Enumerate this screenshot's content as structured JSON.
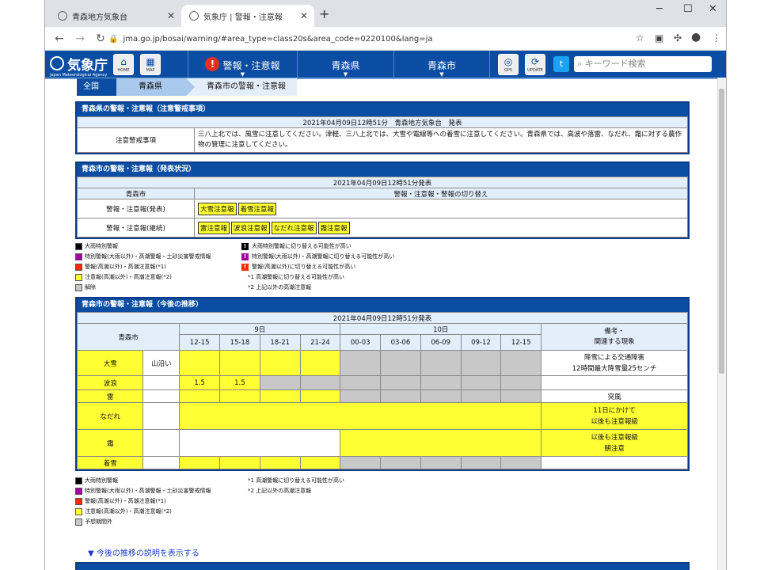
{
  "browser": {
    "tabs": [
      {
        "title": "青森地方気象台"
      },
      {
        "title": "気象庁 | 警報・注意報"
      }
    ],
    "url": "jma.go.jp/bosai/warning/#area_type=class20s&area_code=0220100&lang=ja"
  },
  "site": {
    "logo_text": "気象庁",
    "logo_en": "Japan Meteorological Agency",
    "home_label": "HOME",
    "map_label": "MAP",
    "menu": [
      {
        "label": "警報・注意報"
      },
      {
        "label": "青森県"
      },
      {
        "label": "青森市"
      }
    ],
    "gps_label": "GPS",
    "update_label": "UPDATE",
    "search_placeholder": "キーワード検索"
  },
  "breadcrumb": [
    "全国",
    "青森県",
    "青森市の警報・注意報"
  ],
  "sec1": {
    "title": "青森県の警報・注意報（注意警戒事項）",
    "issued": "2021年04月09日12時51分　青森地方気象台　発表",
    "row_label": "注意警戒事項",
    "text": "三八上北では、風雪に注意してください。津軽、三八上北では、大雪や電線等への着雪に注意してください。青森県では、高波や落雷、なだれ、霜に対する農作物の管理に注意してください。"
  },
  "sec2": {
    "title": "青森市の警報・注意報（発表状況）",
    "issued": "2021年04月09日12時51分発表",
    "col1": "青森市",
    "col2": "警報・注意報・警報の切り替え",
    "row1_label": "警報・注意報(発表)",
    "row1_tags": [
      "大雪注意報",
      "着雪注意報"
    ],
    "row2_label": "警報・注意報(継続)",
    "row2_tags": [
      "雷注意報",
      "波浪注意報",
      "なだれ注意報",
      "霜注意報"
    ]
  },
  "legend1": {
    "left": [
      "大雨特別警報",
      "特別警報(大雨以外)・高潮警報・土砂災害警戒情報",
      "警報(高潮以外)・高潮注意報(*1)",
      "注意報(高潮以外)・高潮注意報(*2)",
      "解除"
    ],
    "right": [
      "大雨特別警報に切り替える可能性が高い",
      "特別警報(大雨以外)・高潮警報に切り替える可能性が高い",
      "警報(高潮以外)に切り替える可能性が高い",
      "*1 高潮警報に切り替える可能性が高い",
      "*2 上記以外の高潮注意報"
    ],
    "colors": [
      "#000000",
      "#a000a0",
      "#ff2800",
      "#ffff33",
      "#c8c8c8"
    ]
  },
  "sec3": {
    "title": "青森市の警報・注意報（今後の推移）",
    "issued": "2021年04月09日12時51分発表",
    "area": "青森市",
    "day1": "9日",
    "day2": "10日",
    "times": [
      "12-15",
      "15-18",
      "18-21",
      "21-24",
      "00-03",
      "03-06",
      "06-09",
      "09-12",
      "12-15"
    ],
    "remark_header1": "備考・",
    "remark_header2": "関連する現象",
    "rows": [
      {
        "name": "大雪",
        "sub": "山沿い",
        "remark": [
          "降雪による交通障害",
          "12時間最大降雪量25センチ"
        ]
      },
      {
        "name": "波浪",
        "sub": "",
        "cells": [
          "1.5",
          "1.5"
        ],
        "remark": []
      },
      {
        "name": "雷",
        "sub": "",
        "remark": [
          "突風"
        ]
      },
      {
        "name": "なだれ",
        "sub": "",
        "remark": [
          "11日にかけて",
          "以後も注意報級"
        ]
      },
      {
        "name": "霜",
        "sub": "",
        "remark": [
          "以後も注意報級",
          "朝注意"
        ]
      },
      {
        "name": "着雪",
        "sub": "",
        "remark": []
      }
    ]
  },
  "legend2": {
    "left": [
      "大雨特別警報",
      "特別警報(大雨以外)・高潮警報・土砂災害警戒情報",
      "警報(高潮以外)・高潮注意報(*1)",
      "注意報(高潮以外)・高潮注意報(*2)",
      "予想期間外"
    ],
    "right": [
      "*1 高潮警報に切り替える可能性が高い",
      "*2 上記以外の高潮注意報"
    ]
  },
  "explain_link": "▼ 今後の推移の説明を表示する"
}
